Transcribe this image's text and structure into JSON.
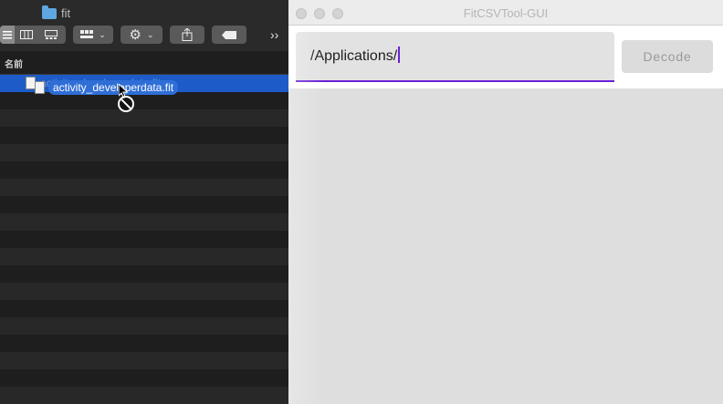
{
  "finder": {
    "folder_name": "fit",
    "column_header": "名前",
    "selected_file": "activity_developerdata.fit",
    "drag_label": "activity_developerdata.fit",
    "toolbar": {
      "view_icons": [
        "list-view-icon",
        "column-view-icon",
        "gallery-view-icon"
      ],
      "group_icon": "grid-icon",
      "action_icon": "gear-icon",
      "share_icon": "share-icon",
      "tag_icon": "tag-icon",
      "more": "››"
    }
  },
  "app": {
    "window_title": "FitCSVTool-GUI",
    "path_field": {
      "value": "/Applications/"
    },
    "decode_button": "Decode",
    "colors": {
      "accent": "#6a1fd6",
      "selection": "#1d5cc8"
    }
  }
}
